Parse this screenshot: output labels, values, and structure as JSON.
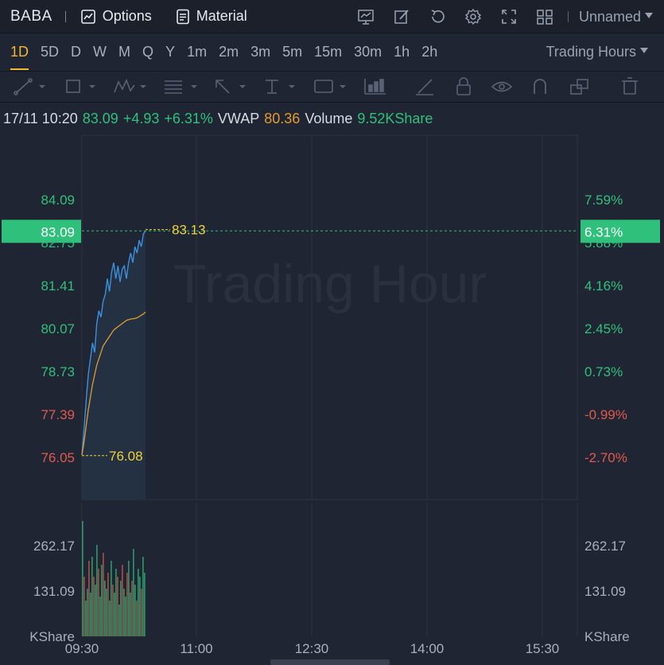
{
  "topbar": {
    "ticker": "BABA",
    "options_label": "Options",
    "material_label": "Material",
    "layout_label": "Unnamed",
    "tool_icons": [
      "chart-settings-icon",
      "draw-icon",
      "reset-icon",
      "gear-icon",
      "fullscreen-icon",
      "layout-grid-icon"
    ]
  },
  "timeframes": [
    "1D",
    "5D",
    "D",
    "W",
    "M",
    "Q",
    "Y",
    "1m",
    "2m",
    "3m",
    "5m",
    "15m",
    "30m",
    "1h",
    "2h"
  ],
  "active_timeframe": "1D",
  "session_label": "Trading Hours",
  "drawing_tools": [
    "trendline-icon",
    "rectangle-icon",
    "pattern-icon",
    "fibonacci-icon",
    "arrow-icon",
    "measure-icon",
    "text-note-icon",
    "bar-pattern-icon",
    "pencil-icon",
    "lock-icon",
    "eye-icon",
    "magnet-icon",
    "layers-icon",
    "trash-icon"
  ],
  "info": {
    "datetime": "17/11 10:20",
    "price": "83.09",
    "change": "+4.93",
    "change_pct": "+6.31%",
    "vwap_label": "VWAP",
    "vwap_value": "80.36",
    "volume_label": "Volume",
    "volume_value": "9.52KShare"
  },
  "watermark": "Trading Hour",
  "colors": {
    "up": "#2fc07c",
    "down": "#e0594f",
    "price_line": "#3d8fe0",
    "vwap_line": "#e39b2f",
    "marker": "#f0d232",
    "active": "#f3b72f"
  },
  "chart_data": {
    "type": "line",
    "x_ticks": [
      "09:30",
      "11:00",
      "12:30",
      "14:00",
      "15:30"
    ],
    "price_ticks": [
      "84.09",
      "82.75",
      "81.41",
      "80.07",
      "78.73",
      "77.39",
      "76.05"
    ],
    "pct_ticks": [
      "7.59%",
      "5.88%",
      "4.16%",
      "2.45%",
      "0.73%",
      "-0.99%",
      "-2.70%"
    ],
    "ylim": [
      76.05,
      84.09
    ],
    "current_price_label": "83.09",
    "current_pct_label": "6.31%",
    "current_price": 83.09,
    "high_label": "83.13",
    "low_label": "76.08",
    "high": 83.13,
    "low": 76.08,
    "volume_ticks": [
      "262.17",
      "131.09",
      "KShare"
    ],
    "volume_ticks_right": [
      "262.17",
      "131.09",
      "KShare"
    ],
    "series": [
      {
        "name": "Price",
        "values": [
          76.1,
          76.9,
          77.8,
          78.6,
          79.1,
          79.6,
          79.3,
          80.2,
          80.6,
          80.4,
          80.9,
          81.1,
          81.6,
          81.2,
          81.8,
          82.1,
          81.6,
          82.0,
          81.5,
          81.9,
          82.0,
          81.6,
          82.1,
          82.4,
          82.1,
          82.6,
          82.4,
          82.8,
          82.6,
          83.0,
          83.09
        ]
      },
      {
        "name": "VWAP",
        "values": [
          76.1,
          76.5,
          77.0,
          77.5,
          77.9,
          78.3,
          78.6,
          78.9,
          79.1,
          79.3,
          79.5,
          79.6,
          79.7,
          79.8,
          79.9,
          80.0,
          80.05,
          80.1,
          80.15,
          80.2,
          80.25,
          80.3,
          80.32,
          80.34,
          80.35,
          80.36,
          80.38,
          80.42,
          80.46,
          80.5,
          80.56
        ]
      }
    ],
    "volume": [
      290,
      150,
      90,
      120,
      190,
      110,
      200,
      150,
      130,
      230,
      170,
      100,
      180,
      210,
      140,
      120,
      160,
      90,
      190,
      130,
      110,
      170,
      150,
      80,
      140,
      180,
      120,
      100,
      160,
      190,
      110,
      140,
      220,
      130,
      90,
      170,
      150,
      120,
      200,
      160
    ],
    "volume_max": 320
  }
}
